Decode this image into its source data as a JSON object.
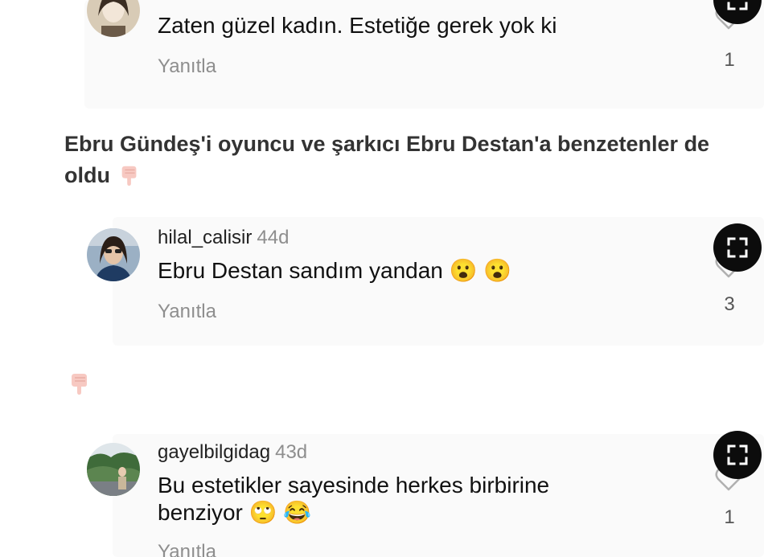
{
  "comments": [
    {
      "username": "",
      "time": "",
      "text": "Zaten güzel kadın. Estetiğe gerek yok ki",
      "reply_label": "Yanıtla",
      "like_count": "1"
    },
    {
      "username": "hilal_calisir",
      "time": "44d",
      "text": "Ebru Destan sandım yandan",
      "emoji": "😮 😮",
      "reply_label": "Yanıtla",
      "like_count": "3"
    },
    {
      "username": "gayelbilgidag",
      "time": "43d",
      "text_line1": "Bu estetikler sayesinde herkes birbirine",
      "text_line2": "benziyor",
      "emoji": "🙄 😂",
      "reply_label": "Yanıtla",
      "like_count": "1"
    }
  ],
  "heading": "Ebru Gündeş'i oyuncu ve şarkıcı Ebru Destan'a benzetenler de oldu",
  "colors": {
    "secondary_text": "#8e8e8e",
    "expand_button": "#0c0c0c",
    "card_background": "#fafafa"
  },
  "icons": {
    "expand": "expand-icon",
    "like": "heart-icon",
    "pointing": "pointing-down-hand-icon"
  }
}
